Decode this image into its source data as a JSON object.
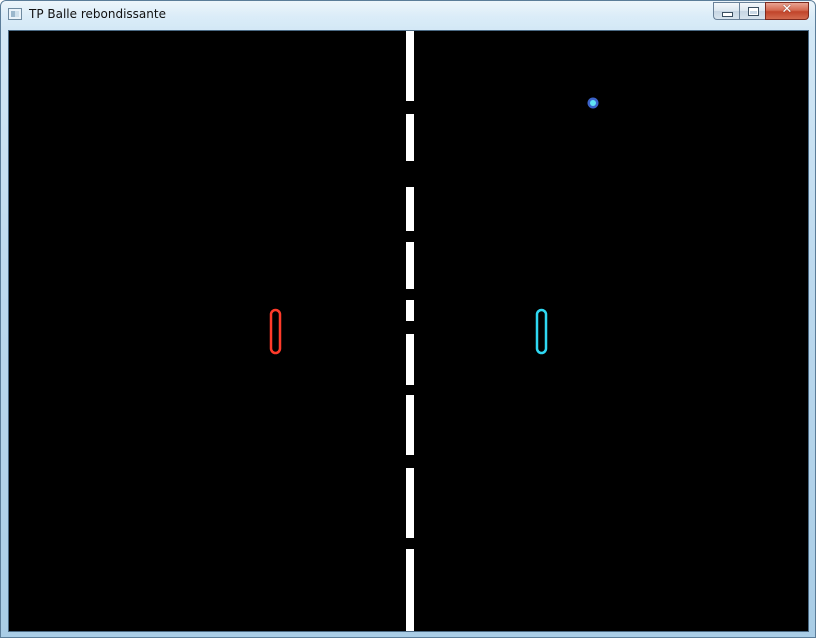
{
  "window": {
    "title": "TP Balle rebondissante",
    "close_glyph": "✕",
    "app_icon": "window-app-icon",
    "buttons": [
      "minimize-icon",
      "maximize-icon",
      "close-icon"
    ]
  },
  "game": {
    "background_color": "#000000",
    "net_color": "#ffffff",
    "left_paddle": {
      "stroke_color": "#ff3b2a",
      "fill_color": "#000000"
    },
    "right_paddle": {
      "stroke_color": "#2fd8f2",
      "fill_color": "#000000"
    },
    "ball": {
      "outer_color": "#3b63c9",
      "inner_color": "#5fe3f2"
    }
  }
}
